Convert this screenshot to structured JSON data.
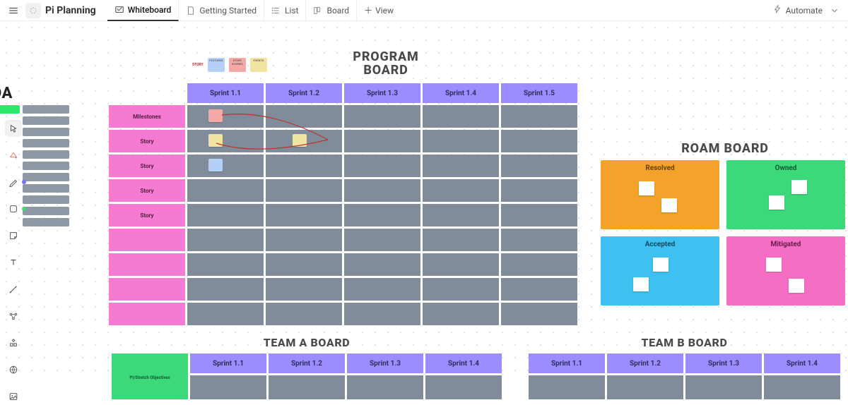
{
  "app": {
    "title": "Pi Planning"
  },
  "nav": {
    "tabs": [
      {
        "label": "Whiteboard",
        "icon": "whiteboard-icon"
      },
      {
        "label": "Getting Started",
        "icon": "doc-icon"
      },
      {
        "label": "List",
        "icon": "list-icon"
      },
      {
        "label": "Board",
        "icon": "board-icon"
      }
    ],
    "view_label": "View",
    "automate_label": "Automate"
  },
  "agenda": {
    "title": "NDA"
  },
  "legend": {
    "label1": "STORY",
    "chip1": "FEATURES",
    "chip2": "STORY STORIES",
    "chip3": "EVENTS"
  },
  "program_board": {
    "title": "PROGRAM BOARD",
    "sprints": [
      "Sprint 1.1",
      "Sprint 1.2",
      "Sprint 1.3",
      "Sprint 1.4",
      "Sprint 1.5"
    ],
    "rows": [
      "Milestones",
      "Story",
      "Story",
      "Story",
      "Story",
      "",
      "",
      "",
      ""
    ]
  },
  "roam": {
    "title": "ROAM BOARD",
    "cells": [
      "Resolved",
      "Owned",
      "Accepted",
      "Mitigated"
    ]
  },
  "team_a": {
    "title": "TEAM A BOARD",
    "sprints": [
      "Sprint 1.1",
      "Sprint 1.2",
      "Sprint 1.3",
      "Sprint 1.4"
    ],
    "obj": "PI/Stretch Objectives"
  },
  "team_b": {
    "title": "TEAM B BOARD",
    "sprints": [
      "Sprint 1.1",
      "Sprint 1.2",
      "Sprint 1.3",
      "Sprint 1.4"
    ]
  },
  "colors": {
    "purple": "#9b8cff",
    "pink": "#f47bd1",
    "grey": "#808c99",
    "blue_note": "#b5d0f7",
    "pink_note": "#f3a9a5",
    "yellow_note": "#f1e3a1"
  }
}
